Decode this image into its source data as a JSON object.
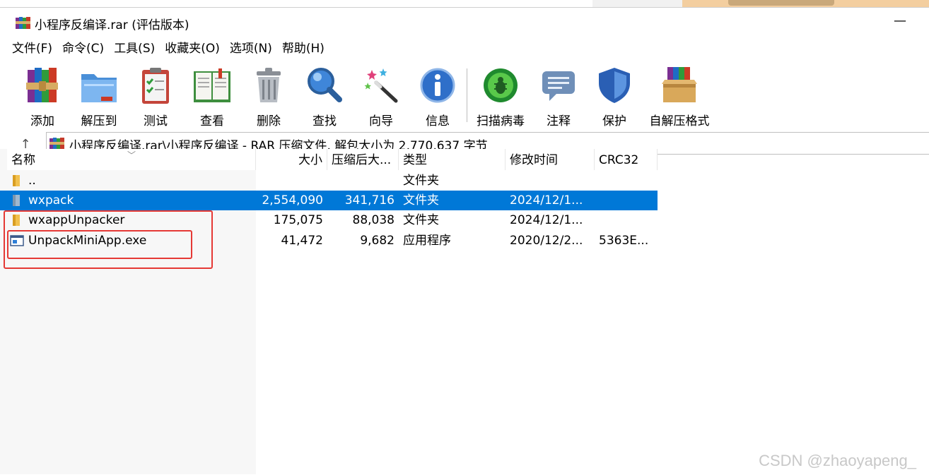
{
  "window": {
    "title": "小程序反编译.rar (评估版本)",
    "minimize_glyph": "—"
  },
  "menu": [
    {
      "label": "文件(F)"
    },
    {
      "label": "命令(C)"
    },
    {
      "label": "工具(S)"
    },
    {
      "label": "收藏夹(O)"
    },
    {
      "label": "选项(N)"
    },
    {
      "label": "帮助(H)"
    }
  ],
  "toolbar": [
    {
      "label": "添加",
      "icon": "books-add-icon"
    },
    {
      "label": "解压到",
      "icon": "folder-extract-icon"
    },
    {
      "label": "测试",
      "icon": "clipboard-test-icon"
    },
    {
      "label": "查看",
      "icon": "book-view-icon"
    },
    {
      "label": "删除",
      "icon": "trash-icon"
    },
    {
      "label": "查找",
      "icon": "magnifier-icon"
    },
    {
      "label": "向导",
      "icon": "wand-icon"
    },
    {
      "label": "信息",
      "icon": "info-icon"
    },
    {
      "label": "扫描病毒",
      "icon": "bug-scan-icon"
    },
    {
      "label": "注释",
      "icon": "comment-icon"
    },
    {
      "label": "保护",
      "icon": "shield-icon"
    },
    {
      "label": "自解压格式",
      "icon": "sfx-box-icon"
    }
  ],
  "address": {
    "up_glyph": "↑",
    "path": "小程序反编译.rar\\小程序反编译 - RAR 压缩文件, 解包大小为 2,770,637 字节"
  },
  "columns": {
    "name": "名称",
    "size": "大小",
    "packed": "压缩后大...",
    "type": "类型",
    "modified": "修改时间",
    "crc": "CRC32",
    "sort_glyph": "﹀"
  },
  "files": [
    {
      "name": "..",
      "size": "",
      "packed": "",
      "type": "文件夹",
      "modified": "",
      "crc": "",
      "kind": "folder",
      "selected": false
    },
    {
      "name": "wxpack",
      "size": "2,554,090",
      "packed": "341,716",
      "type": "文件夹",
      "modified": "2024/12/1...",
      "crc": "",
      "kind": "folder",
      "selected": true
    },
    {
      "name": "wxappUnpacker",
      "size": "175,075",
      "packed": "88,038",
      "type": "文件夹",
      "modified": "2024/12/1...",
      "crc": "",
      "kind": "folder",
      "selected": false
    },
    {
      "name": "UnpackMiniApp.exe",
      "size": "41,472",
      "packed": "9,682",
      "type": "应用程序",
      "modified": "2020/12/2...",
      "crc": "5363E...",
      "kind": "exe",
      "selected": false
    }
  ],
  "watermark": "CSDN @zhaoyapeng_",
  "colors": {
    "selection": "#0078d7",
    "annotation": "#e53935"
  }
}
